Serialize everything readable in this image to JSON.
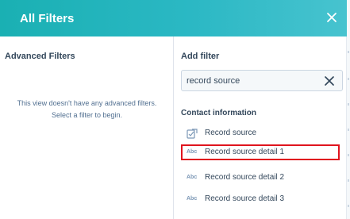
{
  "dialog": {
    "title": "All Filters"
  },
  "advanced": {
    "heading": "Advanced Filters",
    "empty_line1": "This view doesn't have any advanced filters.",
    "empty_line2": "Select a filter to begin."
  },
  "add_filter": {
    "heading": "Add filter",
    "search_value": "record source",
    "group_heading": "Contact information",
    "options": [
      {
        "label": "Record source",
        "icon": "checklist-icon"
      },
      {
        "label": "Record source detail 1",
        "icon": "abc-text-icon",
        "icon_text": "Abc",
        "highlighted": true
      },
      {
        "label": "Record source detail 2",
        "icon": "abc-text-icon",
        "icon_text": "Abc"
      },
      {
        "label": "Record source detail 3",
        "icon": "abc-text-icon",
        "icon_text": "Abc"
      }
    ]
  },
  "colors": {
    "header_start": "#1ab0b3",
    "header_end": "#47c3cf",
    "highlight_border": "#e0141e",
    "text": "#33475b"
  }
}
